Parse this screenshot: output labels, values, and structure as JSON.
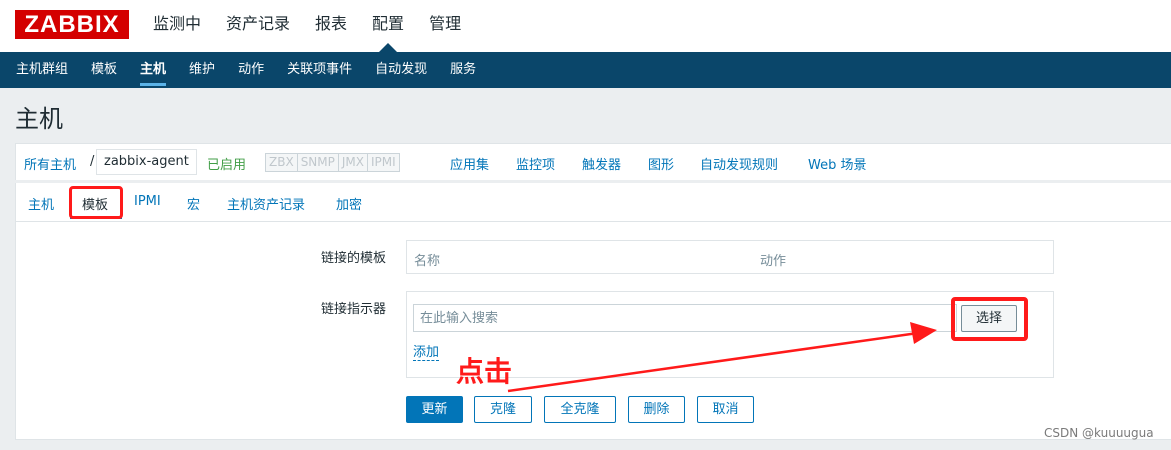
{
  "header": {
    "logo": "ZABBIX",
    "menu": [
      "监测中",
      "资产记录",
      "报表",
      "配置",
      "管理"
    ],
    "active_index": 3
  },
  "subnav": {
    "items": [
      "主机群组",
      "模板",
      "主机",
      "维护",
      "动作",
      "关联项事件",
      "自动发现",
      "服务"
    ],
    "active_index": 2
  },
  "page": {
    "title": "主机"
  },
  "hostbar": {
    "all_hosts": "所有主机",
    "separator": "/",
    "host_name": "zabbix-agent",
    "status": "已启用",
    "protocols": [
      "ZBX",
      "SNMP",
      "JMX",
      "IPMI"
    ],
    "links": [
      "应用集",
      "监控项",
      "触发器",
      "图形",
      "自动发现规则",
      "Web 场景"
    ]
  },
  "tabs": {
    "items": [
      "主机",
      "模板",
      "IPMI",
      "宏",
      "主机资产记录",
      "加密"
    ],
    "active_index": 1
  },
  "form": {
    "linked_templates_label": "链接的模板",
    "col_name": "名称",
    "col_action": "动作",
    "link_indicator_label": "链接指示器",
    "search_placeholder": "在此输入搜索",
    "select_button": "选择",
    "add_link": "添加"
  },
  "buttons": [
    "更新",
    "克隆",
    "全克隆",
    "删除",
    "取消"
  ],
  "annotation": {
    "text": "点击",
    "color": "#ff1a1a"
  },
  "watermark": "CSDN @kuuuugua",
  "colors": {
    "brand": "#d40000",
    "nav": "#0a466a",
    "link": "#0275b8",
    "enabled": "#429e47"
  }
}
